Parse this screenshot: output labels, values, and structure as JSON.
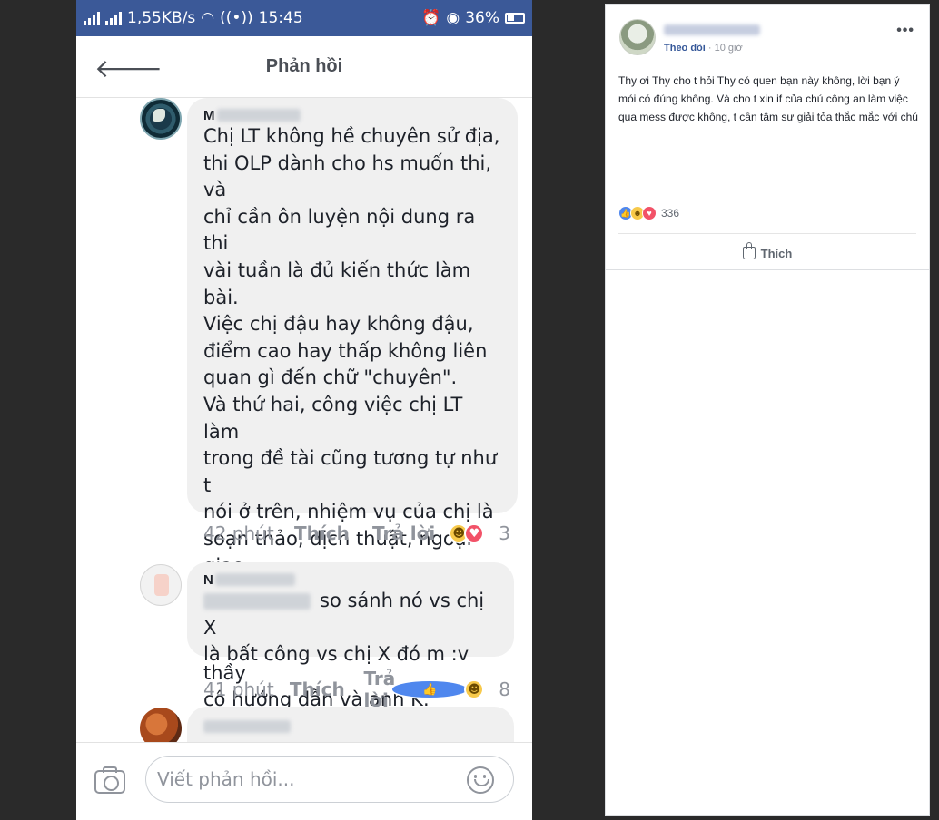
{
  "status_bar": {
    "network_speed": "1,55KB/s",
    "time": "15:45",
    "battery": "36%"
  },
  "nav": {
    "back_icon": "back-arrow-icon",
    "title": "Phản hồi"
  },
  "comments": [
    {
      "name_prefix": "M",
      "text": "Chị LT không hề chuyên sử địa,\nthi OLP dành cho hs muốn thi, và\nchỉ cần ôn luyện nội dung ra thi\nvài tuần là đủ kiến thức làm bài.\nViệc chị đậu hay không đậu,\nđiểm cao hay thấp không liên\nquan gì đến chữ \"chuyên\".\nVà thứ hai, công việc chị LT làm\ntrong đề tài cũng tương tự như t\nnói ở trên, nhiệm vụ của chị là\nsoạn thảo, dịch thuật, ngoại giao\nvà thuyết trình, còn vấn đề phát\ntriển bản vi mạch là của các thầy\ncô hướng dẫn và anh K.",
      "time": "42 phút",
      "like_label": "Thích",
      "reply_label": "Trả lời",
      "reactions": [
        "haha",
        "love"
      ],
      "reaction_count": "3"
    },
    {
      "name_prefix": "N",
      "text_after_tag": "so sánh nó vs chị X\nlà bất công vs chị X đó m :v",
      "time": "41 phút",
      "like_label": "Thích",
      "reply_label": "Trả lời",
      "reactions": [
        "like",
        "haha"
      ],
      "reaction_count": "8"
    },
    {
      "name_prefix": ""
    }
  ],
  "composer": {
    "placeholder": "Viết phản hồi..."
  },
  "post": {
    "follow_label": "Theo dõi",
    "separator": " · ",
    "time": "10 giờ",
    "more_label": "•••",
    "text": "Thy ơi Thy cho t hỏi Thy có quen bạn này không, lời bạn ý mói có đúng không. Và cho t xin if của chú công an làm việc qua mess được không, t cần tâm sự giải tỏa thắc mắc với chú",
    "reactions": [
      "like",
      "haha",
      "love"
    ],
    "reaction_count": "336",
    "like_label": "Thích"
  },
  "colors": {
    "facebook_blue": "#3b5998",
    "link_blue": "#365899",
    "bubble_gray": "#f0f0f0",
    "meta_gray": "#90949c"
  }
}
